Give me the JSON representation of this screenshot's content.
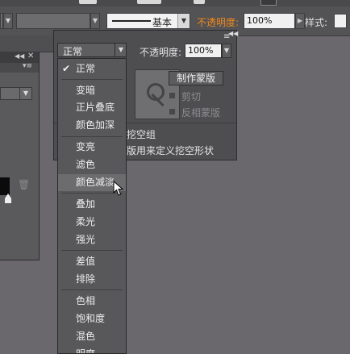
{
  "control_bar": {
    "stroke_style_label": "基本",
    "opacity_label": "不透明度:",
    "opacity_value": "100%",
    "style_label": "样式:",
    "colors": {
      "opacity_label": "#f08a1e"
    }
  },
  "transparency_panel": {
    "blend_mode_value": "正常",
    "opacity_label": "不透明度:",
    "opacity_value": "100%",
    "make_mask_button": "制作蒙版",
    "clip_label": "剪切",
    "invert_mask_label": "反相蒙版",
    "knockout_group_label": "挖空组",
    "opacity_defines_knockout_label": "版用来定义挖空形状"
  },
  "blend_modes": {
    "items": [
      {
        "label": "正常",
        "checked": true
      },
      {
        "label": "变暗"
      },
      {
        "label": "正片叠底"
      },
      {
        "label": "颜色加深"
      },
      {
        "label": "变亮"
      },
      {
        "label": "滤色"
      },
      {
        "label": "颜色减淡",
        "highlighted": true
      },
      {
        "label": "叠加"
      },
      {
        "label": "柔光"
      },
      {
        "label": "强光"
      },
      {
        "label": "差值"
      },
      {
        "label": "排除"
      },
      {
        "label": "色相"
      },
      {
        "label": "饱和度"
      },
      {
        "label": "混色"
      },
      {
        "label": "明度"
      }
    ]
  }
}
